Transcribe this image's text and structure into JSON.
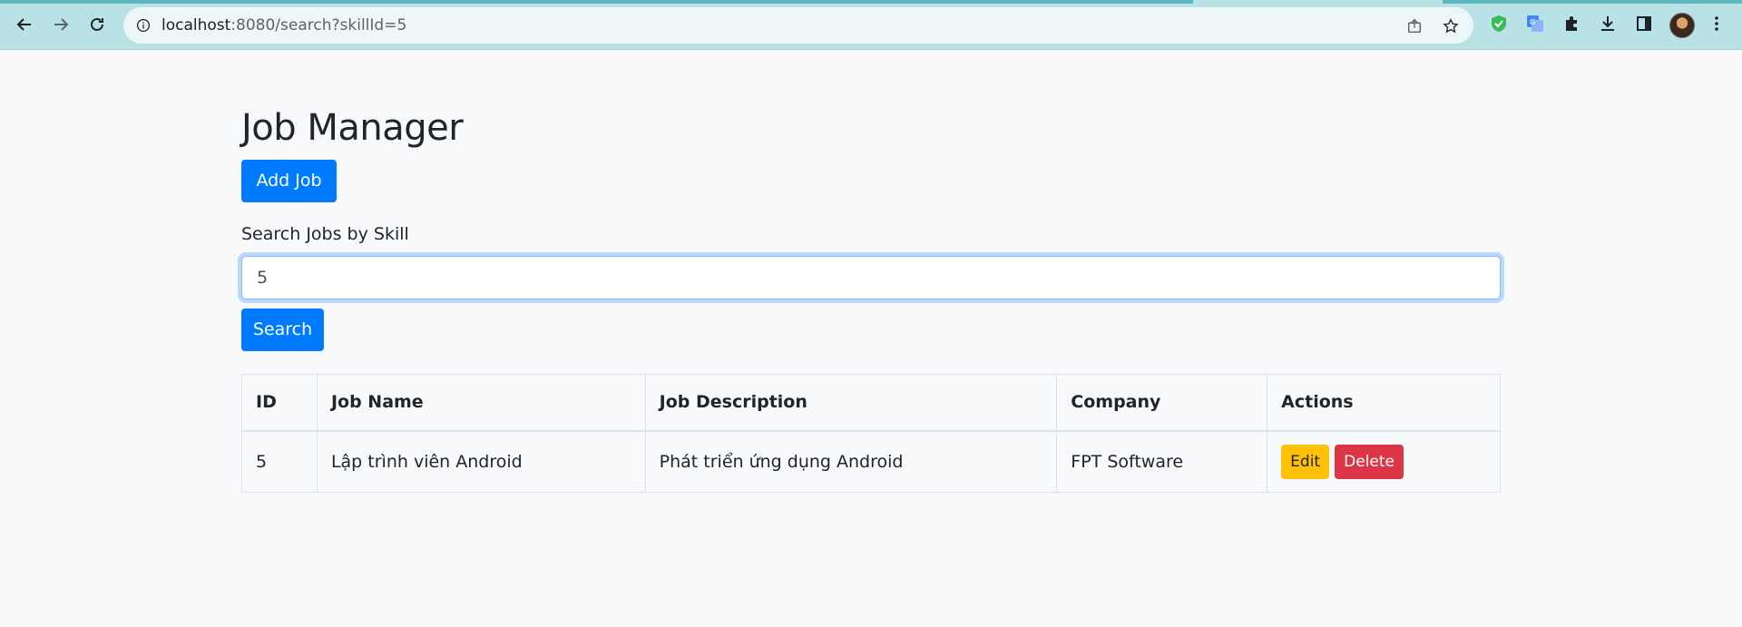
{
  "browser": {
    "url_host": "localhost",
    "url_path": ":8080/search?skillId=5"
  },
  "page": {
    "title": "Job Manager",
    "add_button": "Add Job",
    "search_label": "Search Jobs by Skill",
    "search_value": "5",
    "search_button": "Search"
  },
  "table": {
    "headers": [
      "ID",
      "Job Name",
      "Job Description",
      "Company",
      "Actions"
    ],
    "rows": [
      {
        "id": "5",
        "name": "Lập trình viên Android",
        "description": "Phát triển ứng dụng Android",
        "company": "FPT Software",
        "edit_label": "Edit",
        "delete_label": "Delete"
      }
    ]
  },
  "colors": {
    "primary": "#007bff",
    "warning": "#ffc107",
    "danger": "#dc3545",
    "chrome": "#b9e2e6"
  }
}
